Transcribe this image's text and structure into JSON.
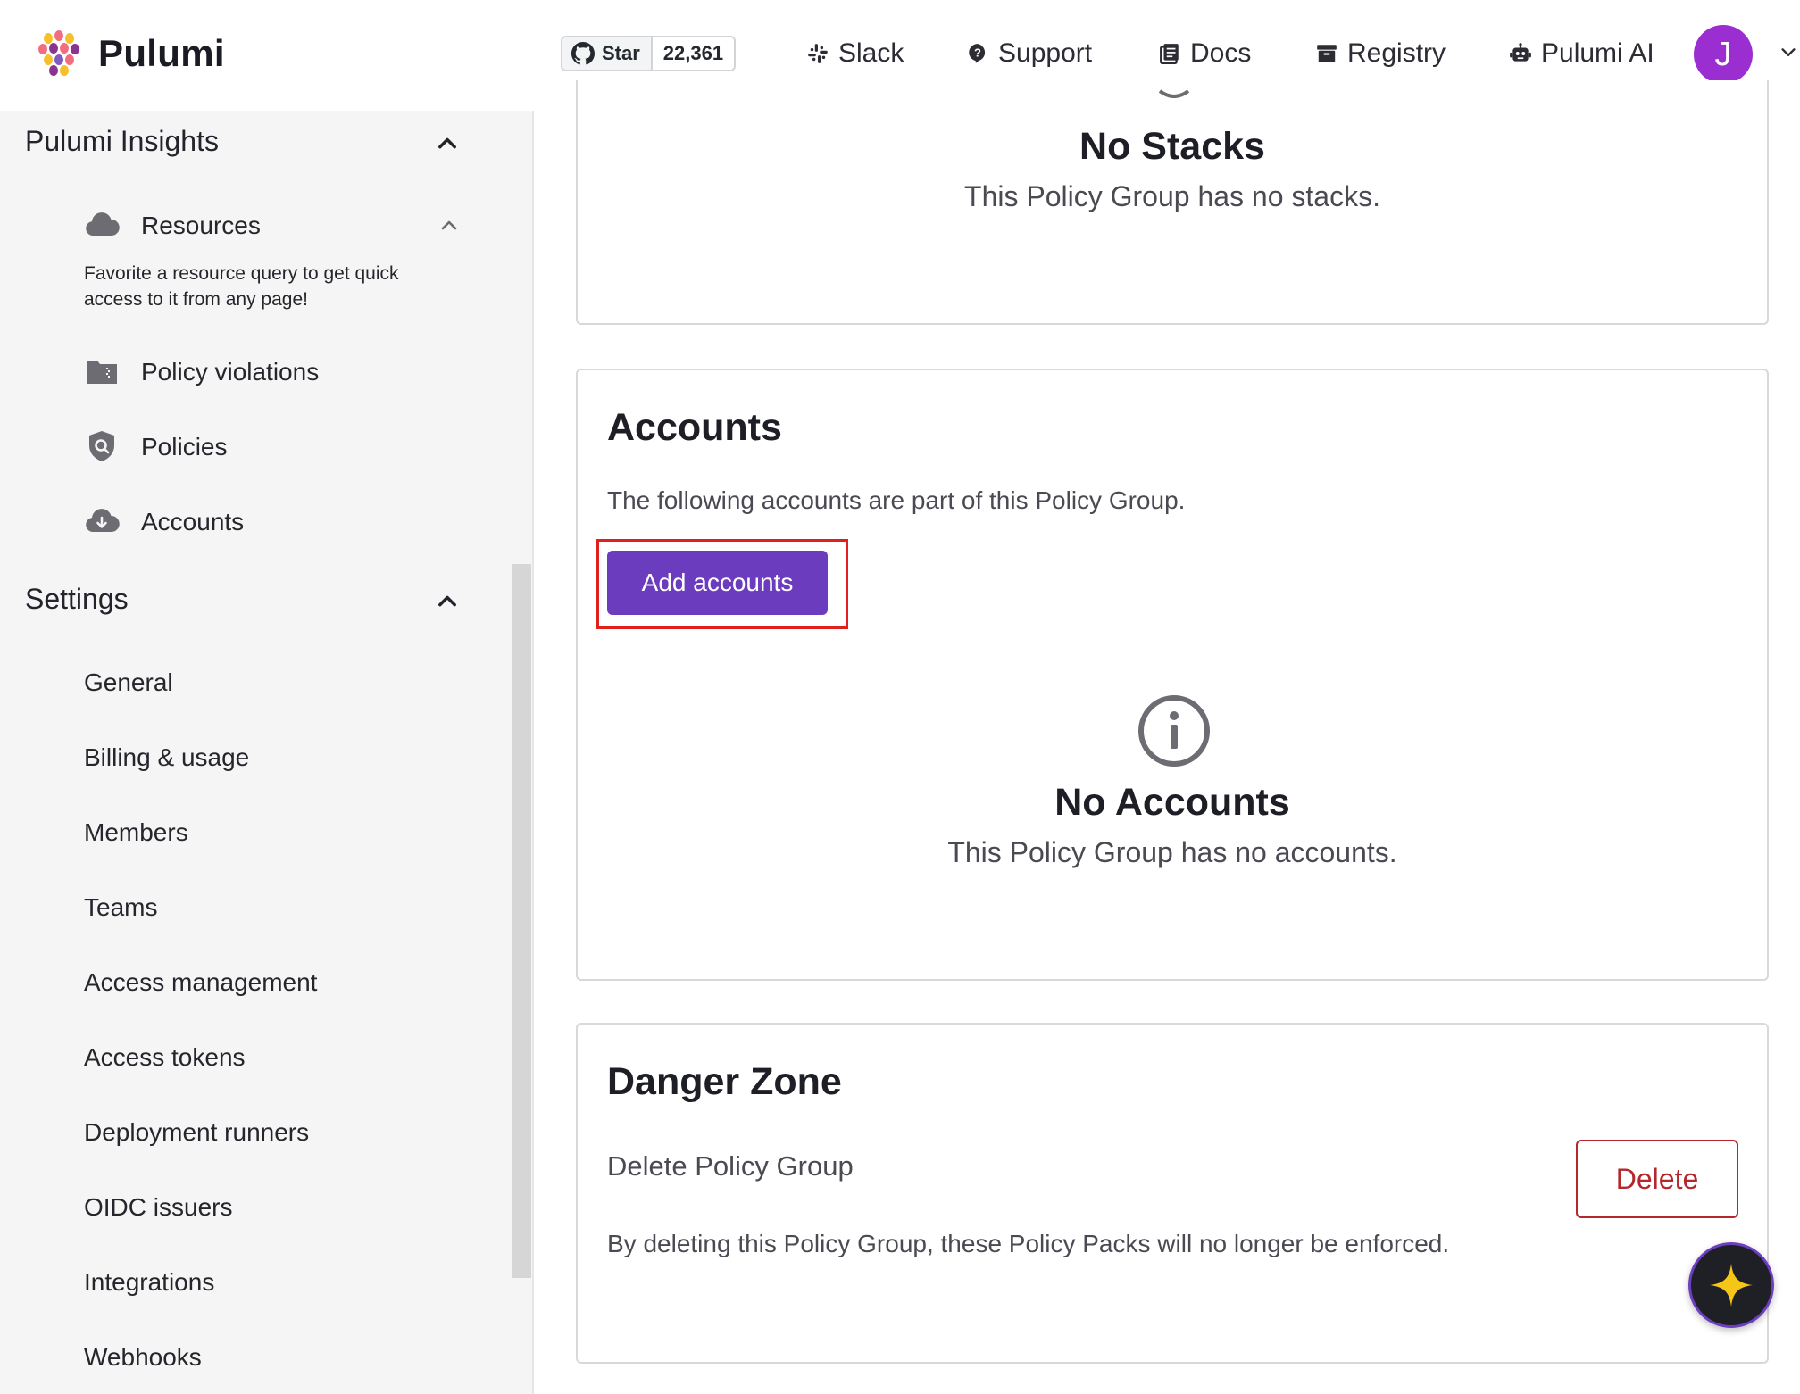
{
  "header": {
    "brand": "Pulumi",
    "github": {
      "star_label": "Star",
      "count": "22,361"
    },
    "nav": [
      {
        "label": "Slack",
        "icon": "slack-icon"
      },
      {
        "label": "Support",
        "icon": "support-icon"
      },
      {
        "label": "Docs",
        "icon": "docs-icon"
      },
      {
        "label": "Registry",
        "icon": "registry-icon"
      },
      {
        "label": "Pulumi AI",
        "icon": "robot-icon"
      }
    ],
    "avatar_initial": "J"
  },
  "sidebar": {
    "insights": {
      "heading": "Pulumi Insights",
      "resources_label": "Resources",
      "resources_help": "Favorite a resource query to get quick access to it from any page!",
      "items": [
        "Policy violations",
        "Policies",
        "Accounts"
      ]
    },
    "settings": {
      "heading": "Settings",
      "items": [
        "General",
        "Billing & usage",
        "Members",
        "Teams",
        "Access management",
        "Access tokens",
        "Deployment runners",
        "OIDC issuers",
        "Integrations",
        "Webhooks"
      ]
    }
  },
  "main": {
    "stacks": {
      "title": "No Stacks",
      "subtitle": "This Policy Group has no stacks."
    },
    "accounts": {
      "title": "Accounts",
      "description": "The following accounts are part of this Policy Group.",
      "add_button": "Add accounts",
      "empty_title": "No Accounts",
      "empty_subtitle": "This Policy Group has no accounts."
    },
    "danger": {
      "title": "Danger Zone",
      "action_label": "Delete Policy Group",
      "description": "By deleting this Policy Group, these Policy Packs will no longer be enforced.",
      "delete_button": "Delete"
    }
  },
  "colors": {
    "accent": "#6b3cbd",
    "danger": "#b3272d",
    "avatar": "#9b2ed1",
    "highlight": "#e0201c"
  }
}
